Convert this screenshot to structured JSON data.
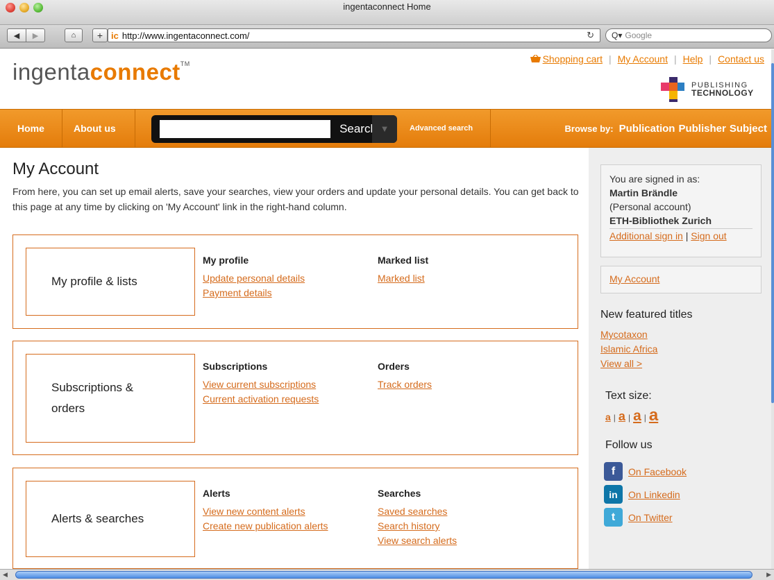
{
  "window": {
    "title": "ingentaconnect Home"
  },
  "browser": {
    "back_label": "◀",
    "forward_label": "▶",
    "home_label": "⌂",
    "plus_label": "+",
    "favicon": "ic",
    "url": "http://www.ingentaconnect.com/",
    "reload_label": "↻",
    "search_placeholder": "Google",
    "search_prefix": "Q▾"
  },
  "header": {
    "logo_part1": "ingenta",
    "logo_part2": "connect",
    "logo_tm": "TM",
    "links": {
      "cart": "Shopping cart",
      "account": "My Account",
      "help": "Help",
      "contact": "Contact us"
    },
    "partner_line1": "PUBLISHING",
    "partner_line2": "TECHNOLOGY"
  },
  "nav": {
    "home": "Home",
    "about": "About us",
    "search_button": "Search",
    "search_input_value": "",
    "search_drop": "▼",
    "advanced": "Advanced search",
    "browse_label": "Browse by:",
    "browse_items": [
      "Publication",
      "Publisher",
      "Subject"
    ]
  },
  "main": {
    "title": "My Account",
    "intro": "From here, you can set up email alerts, save your searches, view your orders and update your personal details. You can get back to this page at any time by clicking on 'My Account' link in the right-hand column.",
    "sections": [
      {
        "tile": "My profile & lists",
        "col1": {
          "heading": "My profile",
          "links": [
            "Update personal details",
            "Payment details"
          ]
        },
        "col2": {
          "heading": "Marked list",
          "links": [
            "Marked list"
          ]
        }
      },
      {
        "tile_line1": "Subscriptions &",
        "tile_line2": "orders",
        "col1": {
          "heading": "Subscriptions",
          "links": [
            "View current subscriptions",
            "Current activation requests"
          ]
        },
        "col2": {
          "heading": "Orders",
          "links": [
            "Track orders"
          ]
        }
      },
      {
        "tile": "Alerts & searches",
        "col1": {
          "heading": "Alerts",
          "links": [
            "View new content alerts",
            "Create new publication alerts"
          ]
        },
        "col2": {
          "heading": "Searches",
          "links": [
            "Saved searches",
            "Search history",
            "View search alerts"
          ]
        }
      }
    ]
  },
  "sidebar": {
    "signed_in_as": "You are signed in as:",
    "user_name": "Martin Brändle",
    "account_type": "(Personal account)",
    "org": "ETH-Bibliothek Zurich",
    "additional_signin": "Additional sign in",
    "signout": "Sign out",
    "pipe": "|",
    "my_account": "My Account",
    "featured_heading": "New featured titles",
    "featured": [
      "Mycotaxon",
      "Islamic Africa"
    ],
    "view_all": "View all >",
    "text_size_heading": "Text size:",
    "text_sizes": [
      "a",
      "a",
      "a",
      "a"
    ],
    "follow_heading": "Follow us",
    "social": [
      {
        "label": "On Facebook",
        "glyph": "f",
        "color": "#3b5998"
      },
      {
        "label": "On Linkedin",
        "glyph": "in",
        "color": "#0e76a8"
      },
      {
        "label": "On Twitter",
        "glyph": "t",
        "color": "#3fa9d8"
      }
    ]
  },
  "colors": {
    "accent": "#e87a00",
    "link": "#d56b1c",
    "border": "#d56b1c"
  }
}
